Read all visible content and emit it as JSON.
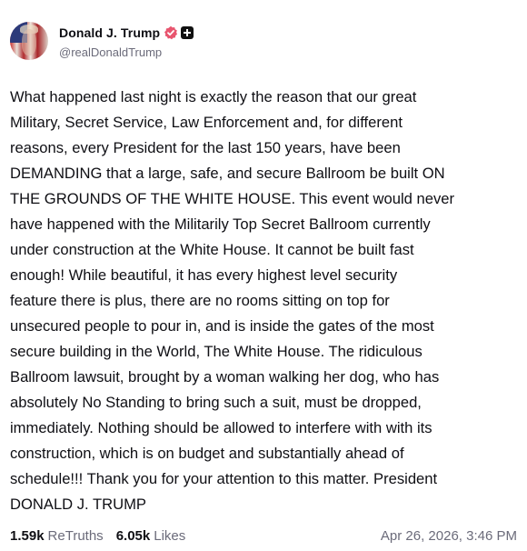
{
  "author": {
    "display_name": "Donald J. Trump",
    "handle": "@realDonaldTrump",
    "verified_icon": "verified-badge-icon",
    "verified_color": "#e8556f",
    "plus_icon": "plus-badge-icon"
  },
  "post": {
    "lines": [
      "What happened last night is exactly the reason that our great",
      "Military, Secret Service, Law Enforcement and, for different",
      "reasons, every President for the last 150 years, have been",
      "DEMANDING that a large, safe, and secure Ballroom be built ON",
      "THE GROUNDS OF THE WHITE HOUSE. This event would never",
      "have happened with the Militarily Top Secret Ballroom currently",
      "under construction at the White House. It cannot be built fast",
      "enough! While beautiful, it has every highest level security",
      "feature there is plus, there are no rooms sitting on top for",
      "unsecured people to pour in, and is inside the gates of the most",
      "secure building in the World, The White House. The ridiculous",
      "Ballroom lawsuit, brought by a woman walking her dog, who has",
      "absolutely No Standing to bring such a suit, must be dropped,",
      "immediately. Nothing should be allowed to interfere with with its",
      "construction, which is on budget and substantially ahead of",
      "schedule!!! Thank you for your attention to this matter. President",
      "DONALD J. TRUMP"
    ]
  },
  "stats": {
    "retruths_count": "1.59k",
    "retruths_label": "ReTruths",
    "likes_count": "6.05k",
    "likes_label": "Likes",
    "timestamp": "Apr 26, 2026, 3:46 PM"
  }
}
